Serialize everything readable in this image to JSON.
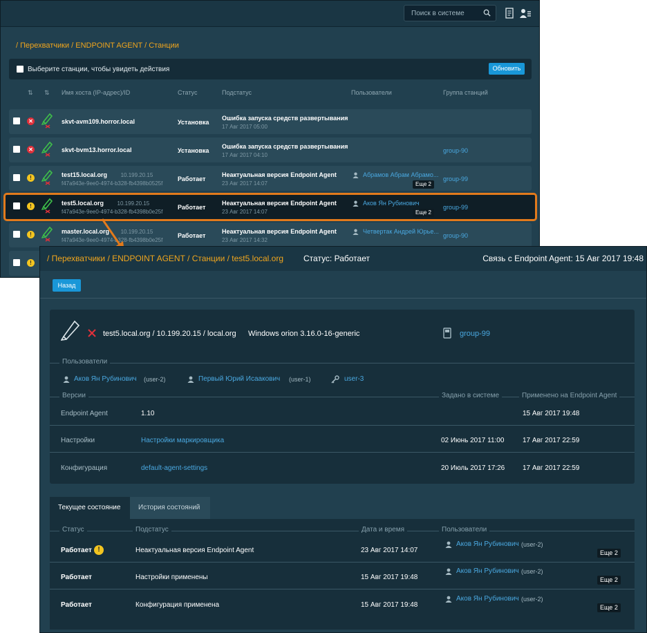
{
  "top": {
    "search_placeholder": "Поиск в системе",
    "breadcrumb": "/ Перехватчики / ENDPOINT AGENT / Станции",
    "select_text": "Выберите станции, чтобы увидеть действия",
    "refresh_label": "Обновить",
    "columns": {
      "sort1": "⇅",
      "sort2": "⇅",
      "host": "Имя хоста (IP-адрес)/ID",
      "status": "Статус",
      "substatus": "Подстатус",
      "users": "Пользователи",
      "group": "Группа станций"
    },
    "rows": [
      {
        "host": "skvt-avm109.horror.local",
        "ip": "",
        "id": "",
        "status": "Установка",
        "substatus": "Ошибка запуска средств развертывания",
        "date": "17 Авг 2017 05:00",
        "user": "",
        "more": "",
        "group": "",
        "state_icon": "error-icon",
        "state_glyph": "✕"
      },
      {
        "host": "skvt-bvm13.horror.local",
        "ip": "",
        "id": "",
        "status": "Установка",
        "substatus": "Ошибка запуска средств развертывания",
        "date": "17 Авг 2017 04:10",
        "user": "",
        "more": "",
        "group": "group-90",
        "state_icon": "error-icon",
        "state_glyph": "✕"
      },
      {
        "host": "test15.local.org",
        "ip": "10.199.20.15",
        "id": "f47a943e-9ee0-4974-b328-fb4398b0525f",
        "status": "Работает",
        "substatus": "Неактуальная версия Endpoint Agent",
        "date": "23 Авг 2017 14:07",
        "user": "Абрамов Абрам Абрамо...",
        "more": "Еще 2",
        "group": "group-99",
        "state_icon": "warning-icon",
        "state_glyph": "!"
      },
      {
        "host": "test5.local.org",
        "ip": "10.199.20.15",
        "id": "f47a943e-9ee0-4974-b328-fb4398b0e25f",
        "status": "Работает",
        "substatus": "Неактуальная версия Endpoint Agent",
        "date": "23 Авг 2017 14:07",
        "user": "Аков Ян Рубинович",
        "more": "Еще 2",
        "group": "group-99",
        "state_icon": "warning-icon",
        "state_glyph": "!"
      },
      {
        "host": "master.local.org",
        "ip": "10.199.20.15",
        "id": "f47a943e-9ee0-4974-b328-fb4398b0e25f",
        "status": "Работает",
        "substatus": "Неактуальная версия Endpoint Agent",
        "date": "23 Авг 2017 14:32",
        "user": "Четвертак Андрей Юрье...",
        "more": "",
        "group": "group-90",
        "state_icon": "warning-icon",
        "state_glyph": "!"
      },
      {
        "host": "",
        "ip": "",
        "id": "",
        "status": "",
        "substatus": "",
        "date": "",
        "user": "",
        "more": "",
        "group": "",
        "state_icon": "warning-icon",
        "state_glyph": "!"
      }
    ]
  },
  "detail": {
    "breadcrumb": "/ Перехватчики / ENDPOINT AGENT / Станции / test5.local.org",
    "status": "Статус: Работает",
    "connection": "Связь с Endpoint Agent: 15 Авг 2017 19:48",
    "back_label": "Назад",
    "host_line": "test5.local.org / 10.199.20.15 / local.org",
    "os": "Windows orion 3.16.0-16-generic",
    "group": "group-99",
    "users_label": "Пользователи",
    "users": [
      {
        "name": "Аков Ян Рубинович",
        "login": "(user-2)"
      },
      {
        "name": "Первый Юрий Исаакович",
        "login": "(user-1)"
      },
      {
        "name": "user-3",
        "login": ""
      }
    ],
    "versions_label": "Версии",
    "set_label": "Задано в системе",
    "applied_label": "Применено на Endpoint Agent",
    "versions": [
      {
        "name": "Endpoint Agent",
        "value": "1.10",
        "set": "",
        "applied": "15 Авг 2017 19:48"
      },
      {
        "name": "Настройки",
        "value": "Настройки маркировщика",
        "set": "02 Июнь 2017 11:00",
        "applied": "17 Авг 2017 22:59"
      },
      {
        "name": "Конфигурация",
        "value": "default-agent-settings",
        "set": "20 Июль 2017 17:26",
        "applied": "17 Авг 2017 22:59"
      }
    ],
    "tabs": [
      "Текущее состояние",
      "История состояний"
    ],
    "history_cols": {
      "status": "Статус",
      "substatus": "Подстатус",
      "datetime": "Дата и время",
      "users": "Пользователи"
    },
    "history": [
      {
        "status": "Работает",
        "warn": "!",
        "substatus": "Неактуальная версия Endpoint Agent",
        "datetime": "23 Авг 2017 14:07",
        "user": "Аков Ян Рубинович",
        "login": "(user-2)",
        "more": "Еще 2"
      },
      {
        "status": "Работает",
        "warn": "",
        "substatus": "Настройки применены",
        "datetime": "15 Авг 2017 19:48",
        "user": "Аков Ян Рубинович",
        "login": "(user-2)",
        "more": "Еще 2"
      },
      {
        "status": "Работает",
        "warn": "",
        "substatus": "Конфигурация применена",
        "datetime": "15 Авг 2017 19:48",
        "user": "Аков Ян Рубинович",
        "login": "(user-2)",
        "more": "Еще 2"
      }
    ]
  }
}
